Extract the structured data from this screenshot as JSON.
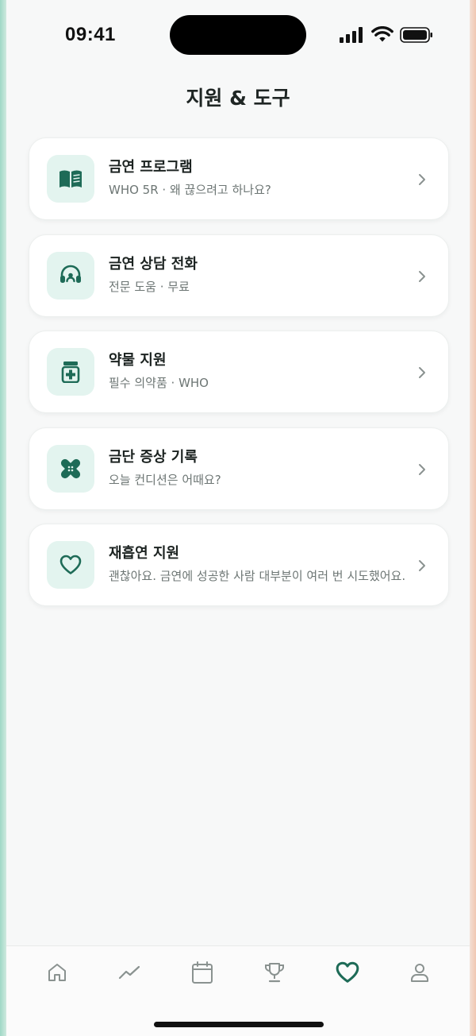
{
  "status_bar": {
    "time": "09:41"
  },
  "page": {
    "title": "지원 & 도구"
  },
  "cards": [
    {
      "title": "금연 프로그램",
      "subtitle": "WHO 5R · 왜 끊으려고 하나요?",
      "icon": "book-open-icon"
    },
    {
      "title": "금연 상담 전화",
      "subtitle": "전문 도움 · 무료",
      "icon": "headset-icon"
    },
    {
      "title": "약물 지원",
      "subtitle": "필수 의약품 · WHO",
      "icon": "medicine-jar-icon"
    },
    {
      "title": "금단 증상 기록",
      "subtitle": "오늘 컨디션은 어때요?",
      "icon": "bandage-icon"
    },
    {
      "title": "재흡연 지원",
      "subtitle": "괜찮아요. 금연에 성공한 사람 대부분이 여러 번 시도했어요.",
      "icon": "heart-icon"
    }
  ],
  "tab_bar": {
    "tabs": [
      {
        "icon": "home-icon",
        "active": false
      },
      {
        "icon": "trend-icon",
        "active": false
      },
      {
        "icon": "calendar-icon",
        "active": false
      },
      {
        "icon": "trophy-icon",
        "active": false
      },
      {
        "icon": "heart-icon",
        "active": true
      },
      {
        "icon": "profile-icon",
        "active": false
      }
    ]
  },
  "colors": {
    "accent": "#1e6b57",
    "icon_bg": "#e3f4ef",
    "inactive_tab": "#8a9290",
    "background": "#f7f8f8"
  }
}
